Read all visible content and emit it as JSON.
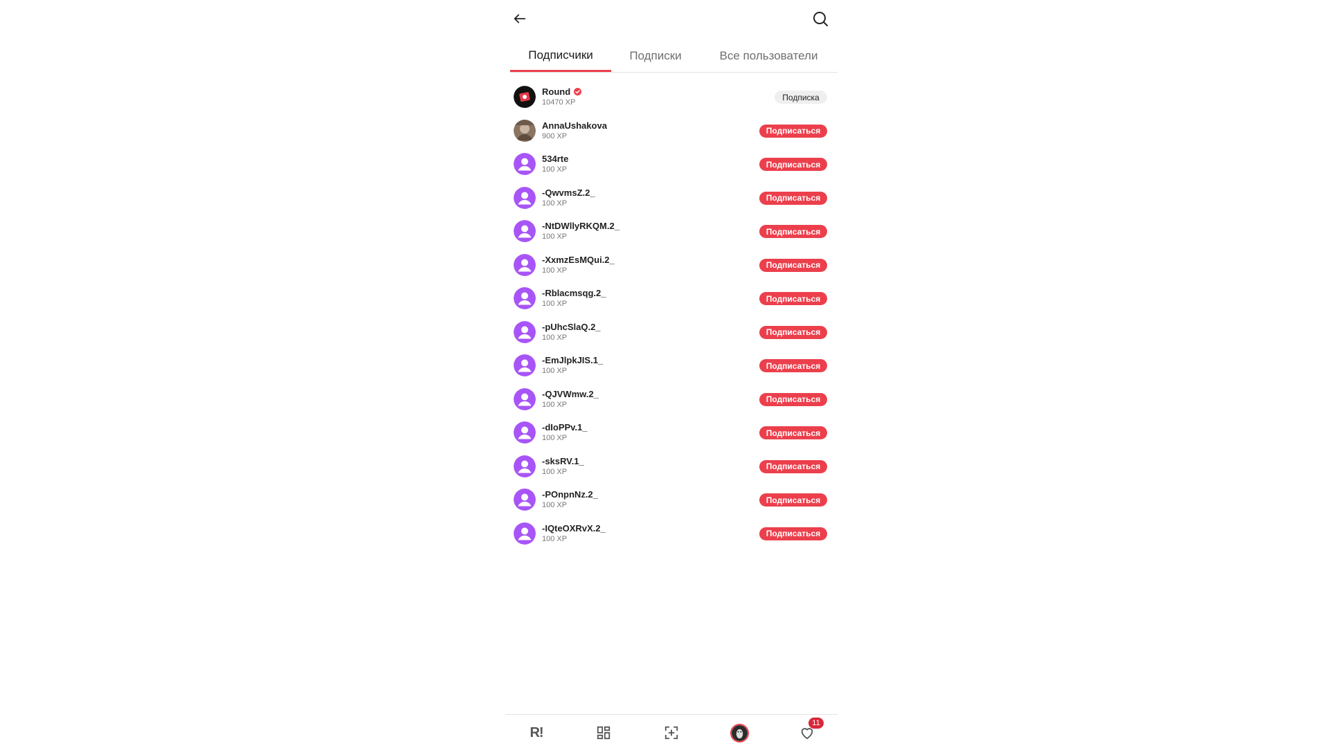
{
  "tabs": [
    {
      "label": "Подписчики",
      "active": true
    },
    {
      "label": "Подписки",
      "active": false
    },
    {
      "label": "Все пользователи",
      "active": false
    }
  ],
  "users": [
    {
      "name": "Round",
      "xp": "10470 XP",
      "verified": true,
      "button": "Подписка",
      "following": true,
      "avatar": "round-logo"
    },
    {
      "name": "AnnaUshakova",
      "xp": "900 XP",
      "verified": false,
      "button": "Подписаться",
      "following": false,
      "avatar": "photo"
    },
    {
      "name": "534rte",
      "xp": "100 XP",
      "verified": false,
      "button": "Подписаться",
      "following": false,
      "avatar": "default"
    },
    {
      "name": "-QwvmsZ.2_",
      "xp": "100 XP",
      "verified": false,
      "button": "Подписаться",
      "following": false,
      "avatar": "default"
    },
    {
      "name": "-NtDWllyRKQM.2_",
      "xp": "100 XP",
      "verified": false,
      "button": "Подписаться",
      "following": false,
      "avatar": "default"
    },
    {
      "name": "-XxmzEsMQui.2_",
      "xp": "100 XP",
      "verified": false,
      "button": "Подписаться",
      "following": false,
      "avatar": "default"
    },
    {
      "name": "-Rblacmsqg.2_",
      "xp": "100 XP",
      "verified": false,
      "button": "Подписаться",
      "following": false,
      "avatar": "default"
    },
    {
      "name": "-pUhcSlaQ.2_",
      "xp": "100 XP",
      "verified": false,
      "button": "Подписаться",
      "following": false,
      "avatar": "default"
    },
    {
      "name": "-EmJlpkJIS.1_",
      "xp": "100 XP",
      "verified": false,
      "button": "Подписаться",
      "following": false,
      "avatar": "default"
    },
    {
      "name": "-QJVWmw.2_",
      "xp": "100 XP",
      "verified": false,
      "button": "Подписаться",
      "following": false,
      "avatar": "default"
    },
    {
      "name": "-dIoPPv.1_",
      "xp": "100 XP",
      "verified": false,
      "button": "Подписаться",
      "following": false,
      "avatar": "default"
    },
    {
      "name": "-sksRV.1_",
      "xp": "100 XP",
      "verified": false,
      "button": "Подписаться",
      "following": false,
      "avatar": "default"
    },
    {
      "name": "-POnpnNz.2_",
      "xp": "100 XP",
      "verified": false,
      "button": "Подписаться",
      "following": false,
      "avatar": "default"
    },
    {
      "name": "-IQteOXRvX.2_",
      "xp": "100 XP",
      "verified": false,
      "button": "Подписаться",
      "following": false,
      "avatar": "default"
    }
  ],
  "bottom_nav": {
    "logo_text": "R!",
    "items": [
      "home-logo",
      "grid-icon",
      "add-scan-icon",
      "profile-avatar",
      "heart-icon"
    ],
    "likes_badge": "11"
  },
  "colors": {
    "accent": "#ec3f4c",
    "default_avatar": "#a855f7",
    "following_button_bg": "#efefef"
  },
  "icons": {
    "back": "arrow-left-icon",
    "search": "search-icon"
  }
}
